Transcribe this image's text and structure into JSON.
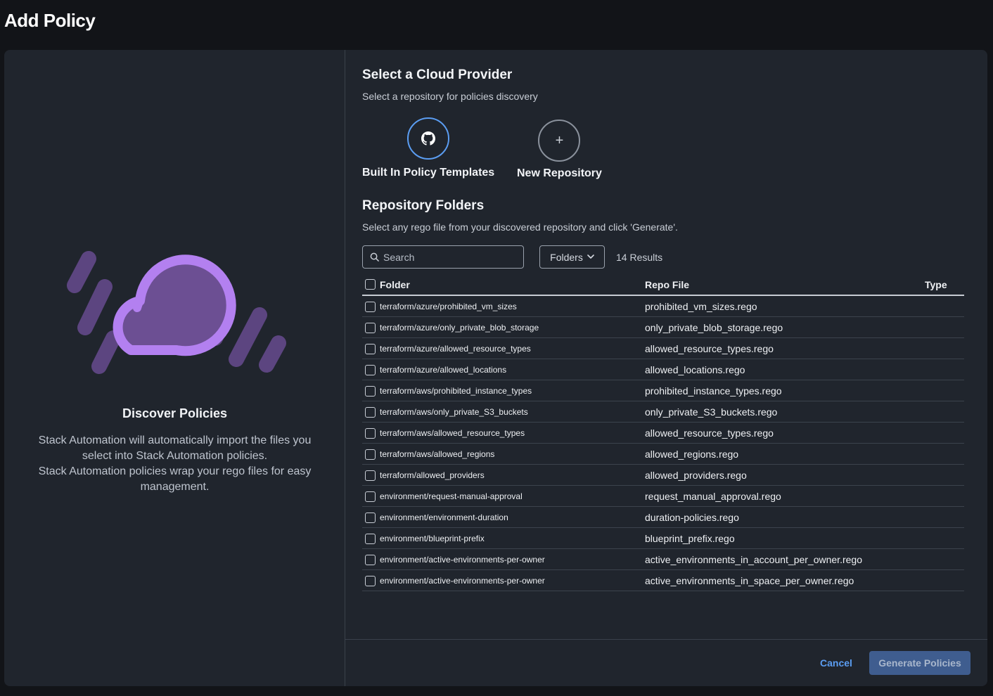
{
  "page": {
    "title": "Add Policy"
  },
  "discover": {
    "title": "Discover Policies",
    "line1": "Stack Automation will automatically import the files you select into Stack Automation policies.",
    "line2": "Stack Automation policies wrap your rego files for easy management."
  },
  "provider_section": {
    "title": "Select a Cloud Provider",
    "subtitle": "Select a repository for policies discovery",
    "options": [
      {
        "label": "Built In Policy Templates",
        "icon": "github-icon",
        "selected": true
      },
      {
        "label": "New Repository",
        "icon": "plus-icon",
        "glyph": "+",
        "selected": false
      }
    ]
  },
  "folders_section": {
    "title": "Repository Folders",
    "subtitle": "Select any rego file from your discovered repository and click 'Generate'.",
    "search": {
      "placeholder": "Search",
      "value": ""
    },
    "filter_label": "Folders",
    "results": "14 Results"
  },
  "table": {
    "headers": {
      "folder": "Folder",
      "repo_file": "Repo File",
      "type": "Type"
    },
    "rows": [
      {
        "folder": "terraform/azure/prohibited_vm_sizes",
        "repo_file": "prohibited_vm_sizes.rego",
        "type": ""
      },
      {
        "folder": "terraform/azure/only_private_blob_storage",
        "repo_file": "only_private_blob_storage.rego",
        "type": ""
      },
      {
        "folder": "terraform/azure/allowed_resource_types",
        "repo_file": "allowed_resource_types.rego",
        "type": ""
      },
      {
        "folder": "terraform/azure/allowed_locations",
        "repo_file": "allowed_locations.rego",
        "type": ""
      },
      {
        "folder": "terraform/aws/prohibited_instance_types",
        "repo_file": "prohibited_instance_types.rego",
        "type": ""
      },
      {
        "folder": "terraform/aws/only_private_S3_buckets",
        "repo_file": "only_private_S3_buckets.rego",
        "type": ""
      },
      {
        "folder": "terraform/aws/allowed_resource_types",
        "repo_file": "allowed_resource_types.rego",
        "type": ""
      },
      {
        "folder": "terraform/aws/allowed_regions",
        "repo_file": "allowed_regions.rego",
        "type": ""
      },
      {
        "folder": "terraform/allowed_providers",
        "repo_file": "allowed_providers.rego",
        "type": ""
      },
      {
        "folder": "environment/request-manual-approval",
        "repo_file": "request_manual_approval.rego",
        "type": ""
      },
      {
        "folder": "environment/environment-duration",
        "repo_file": "duration-policies.rego",
        "type": ""
      },
      {
        "folder": "environment/blueprint-prefix",
        "repo_file": "blueprint_prefix.rego",
        "type": ""
      },
      {
        "folder": "environment/active-environments-per-owner",
        "repo_file": "active_environments_in_account_per_owner.rego",
        "type": ""
      },
      {
        "folder": "environment/active-environments-per-owner",
        "repo_file": "active_environments_in_space_per_owner.rego",
        "type": ""
      }
    ]
  },
  "footer": {
    "cancel_label": "Cancel",
    "generate_label": "Generate Policies"
  },
  "colors": {
    "accent": "#5b9df2",
    "primary_button": "#3f5d8f",
    "illustration": "#b380f0",
    "panel": "#20252d",
    "background": "#121418"
  }
}
